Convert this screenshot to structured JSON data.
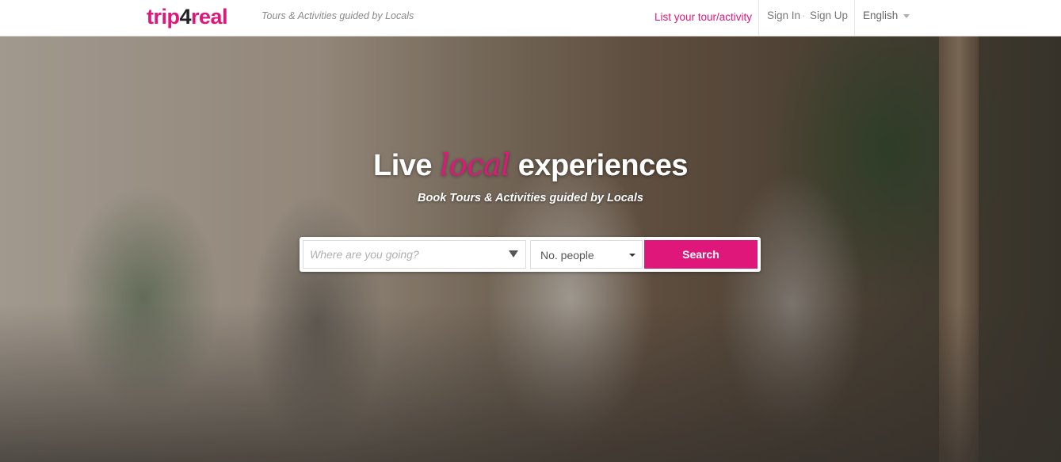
{
  "header": {
    "logo_prefix": "trip",
    "logo_digit": "4",
    "logo_suffix": "real",
    "tagline": "Tours & Activities guided by Locals",
    "list_tour_label": "List your tour/activity",
    "signin_label": "Sign In",
    "separator": "·",
    "signup_label": "Sign Up",
    "language": "English"
  },
  "hero": {
    "headline_before": "Live",
    "headline_accent": "local",
    "headline_after": "experiences",
    "subheadline": "Book Tours & Activities guided by Locals"
  },
  "search": {
    "destination_placeholder": "Where are you going?",
    "people_label": "No. people",
    "button_label": "Search"
  },
  "colors": {
    "brand": "#e0177a",
    "text_muted": "#8a8a8a"
  },
  "icons": {
    "destination_dropdown": "triangle-down-icon",
    "people_dropdown": "caret-down-icon",
    "language_dropdown": "caret-down-icon"
  }
}
